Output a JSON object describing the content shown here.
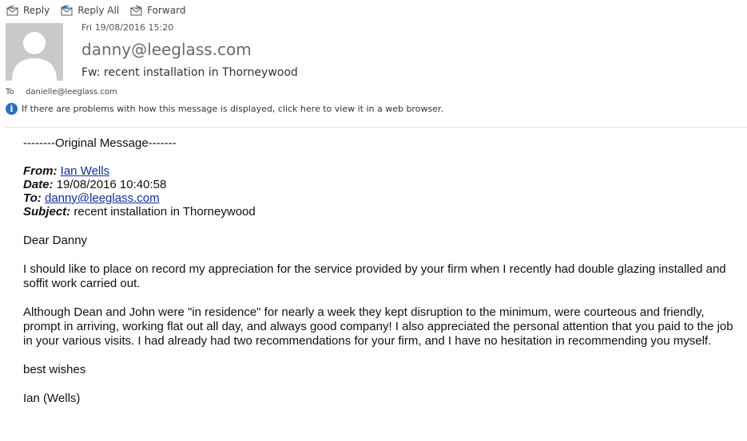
{
  "toolbar": {
    "reply": "Reply",
    "reply_all": "Reply All",
    "forward": "Forward"
  },
  "header": {
    "date": "Fri 19/08/2016 15:20",
    "from": "danny@leeglass.com",
    "subject": "Fw: recent installation in Thorneywood",
    "to_label": "To",
    "to_value": "danielle@leeglass.com",
    "info_text": "If there are problems with how this message is displayed, click here to view it in a web browser."
  },
  "message": {
    "original_marker": "--------Original Message-------",
    "from_label": "From:",
    "from_value": "Ian Wells",
    "date_label": "Date:",
    "date_value": "19/08/2016 10:40:58",
    "to_label": "To:",
    "to_value": "danny@leeglass.com",
    "subject_label": "Subject:",
    "subject_value": "recent installation in Thorneywood",
    "salutation": "Dear Danny",
    "paragraph1": "I should like to place on record my appreciation for the service provided by your firm when I recently had double glazing installed and soffit work carried out.",
    "paragraph2": "Although Dean and John were \"in residence\" for nearly a week they kept disruption to the minimum, were courteous and friendly, prompt in arriving, working flat out all day, and always good company!   I also appreciated the personal attention that you paid  to the job in your various visits.   I had already had two recommendations for your firm, and I have no hesitation in recommending you myself.",
    "signoff": "best wishes",
    "signature": "Ian (Wells)"
  },
  "colors": {
    "avatar_bg": "#c9c9c9",
    "link": "#0b2fa8",
    "info_icon": "#2a70c0"
  }
}
